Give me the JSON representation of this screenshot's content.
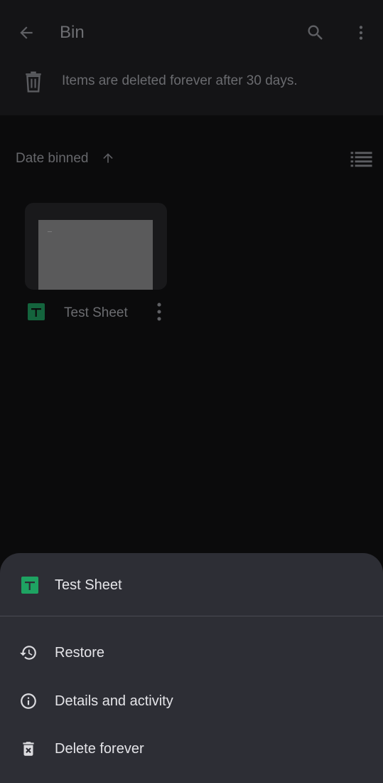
{
  "header": {
    "title": "Bin",
    "back_icon": "arrow-back-icon",
    "search_icon": "search-icon",
    "more_icon": "more-vert-icon"
  },
  "notice": {
    "icon": "trash-icon",
    "text": "Items are deleted forever after 30 days."
  },
  "sort": {
    "label": "Date binned",
    "direction_icon": "arrow-up-icon",
    "view_toggle_icon": "list-view-icon"
  },
  "files": [
    {
      "name": "Test Sheet",
      "type_icon": "google-sheets-icon",
      "more_icon": "more-vert-icon"
    }
  ],
  "bottom_sheet": {
    "file_name": "Test Sheet",
    "file_icon": "google-sheets-icon",
    "items": [
      {
        "label": "Restore",
        "icon": "restore-history-icon"
      },
      {
        "label": "Details and activity",
        "icon": "info-icon"
      },
      {
        "label": "Delete forever",
        "icon": "delete-forever-icon"
      }
    ]
  },
  "colors": {
    "background": "#0b0b0c",
    "sheet_background": "#2d2e35",
    "sheets_green": "#1ea362",
    "dimmed_text": "#6b6c70",
    "sheet_text": "#e6e6ea"
  }
}
